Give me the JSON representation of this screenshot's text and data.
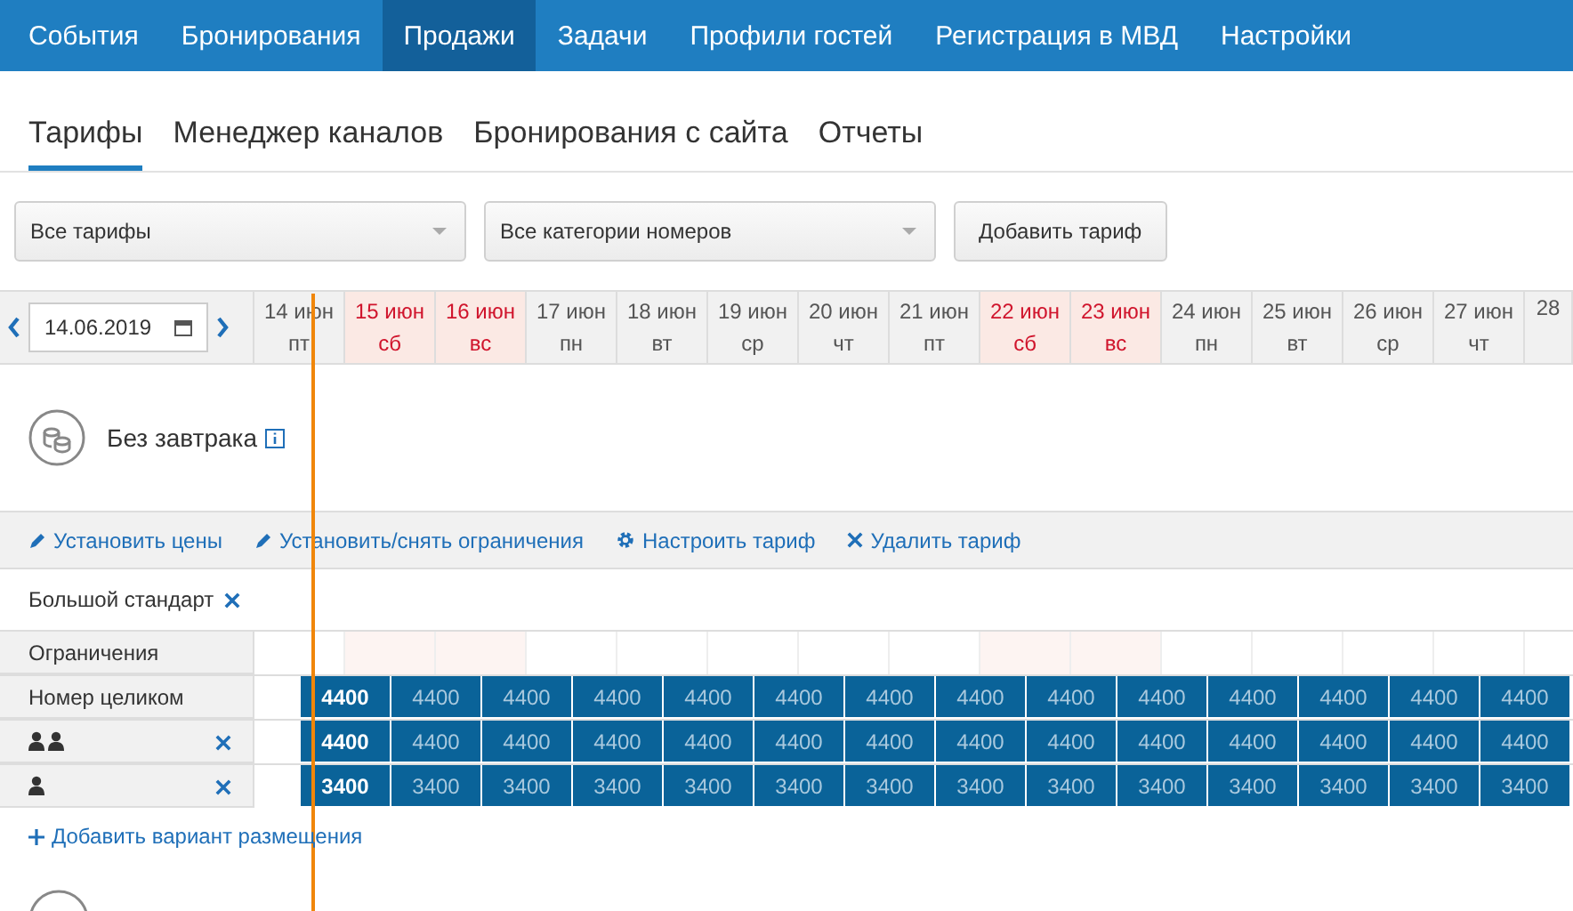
{
  "top_nav": [
    {
      "label": "События",
      "selected": false
    },
    {
      "label": "Бронирования",
      "selected": false
    },
    {
      "label": "Продажи",
      "selected": true
    },
    {
      "label": "Задачи",
      "selected": false
    },
    {
      "label": "Профили гостей",
      "selected": false
    },
    {
      "label": "Регистрация в МВД",
      "selected": false
    },
    {
      "label": "Настройки",
      "selected": false
    }
  ],
  "sub_tabs": [
    {
      "label": "Тарифы",
      "selected": true
    },
    {
      "label": "Менеджер каналов",
      "selected": false
    },
    {
      "label": "Бронирования с сайта",
      "selected": false
    },
    {
      "label": "Отчеты",
      "selected": false
    }
  ],
  "filters": {
    "tariff_select": "Все тарифы",
    "category_select": "Все категории номеров",
    "add_button": "Добавить тариф"
  },
  "date_field": {
    "value": "14.06.2019"
  },
  "days": [
    {
      "date": "14 июн",
      "weekday": "пт",
      "weekend": false
    },
    {
      "date": "15 июн",
      "weekday": "сб",
      "weekend": true
    },
    {
      "date": "16 июн",
      "weekday": "вс",
      "weekend": true
    },
    {
      "date": "17 июн",
      "weekday": "пн",
      "weekend": false
    },
    {
      "date": "18 июн",
      "weekday": "вт",
      "weekend": false
    },
    {
      "date": "19 июн",
      "weekday": "ср",
      "weekend": false
    },
    {
      "date": "20 июн",
      "weekday": "чт",
      "weekend": false
    },
    {
      "date": "21 июн",
      "weekday": "пт",
      "weekend": false
    },
    {
      "date": "22 июн",
      "weekday": "сб",
      "weekend": true
    },
    {
      "date": "23 июн",
      "weekday": "вс",
      "weekend": true
    },
    {
      "date": "24 июн",
      "weekday": "пн",
      "weekend": false
    },
    {
      "date": "25 июн",
      "weekday": "вт",
      "weekend": false
    },
    {
      "date": "26 июн",
      "weekday": "ср",
      "weekend": false
    },
    {
      "date": "27 июн",
      "weekday": "чт",
      "weekend": false
    },
    {
      "date": "28",
      "weekend": false
    }
  ],
  "tariff": {
    "name": "Без завтрака"
  },
  "actions": [
    {
      "kind": "pencil",
      "label": "Установить цены"
    },
    {
      "kind": "pencil",
      "label": "Установить/снять ограничения"
    },
    {
      "kind": "gear",
      "label": "Настроить тариф"
    },
    {
      "kind": "cross",
      "label": "Удалить тариф"
    }
  ],
  "room": {
    "name": "Большой стандарт",
    "restrictions_label": "Ограничения",
    "rows": [
      {
        "kind": "text",
        "label": "Номер целиком",
        "cells": [
          {
            "value": "4400",
            "current": true
          },
          {
            "value": "4400",
            "current": false
          },
          {
            "value": "4400",
            "current": false
          },
          {
            "value": "4400",
            "current": false
          },
          {
            "value": "4400",
            "current": false
          },
          {
            "value": "4400",
            "current": false
          },
          {
            "value": "4400",
            "current": false
          },
          {
            "value": "4400",
            "current": false
          },
          {
            "value": "4400",
            "current": false
          },
          {
            "value": "4400",
            "current": false
          },
          {
            "value": "4400",
            "current": false
          },
          {
            "value": "4400",
            "current": false
          },
          {
            "value": "4400",
            "current": false
          },
          {
            "value": "4400",
            "current": false
          }
        ]
      },
      {
        "kind": "guests2",
        "cells": [
          {
            "value": "4400",
            "current": true
          },
          {
            "value": "4400",
            "current": false
          },
          {
            "value": "4400",
            "current": false
          },
          {
            "value": "4400",
            "current": false
          },
          {
            "value": "4400",
            "current": false
          },
          {
            "value": "4400",
            "current": false
          },
          {
            "value": "4400",
            "current": false
          },
          {
            "value": "4400",
            "current": false
          },
          {
            "value": "4400",
            "current": false
          },
          {
            "value": "4400",
            "current": false
          },
          {
            "value": "4400",
            "current": false
          },
          {
            "value": "4400",
            "current": false
          },
          {
            "value": "4400",
            "current": false
          },
          {
            "value": "4400",
            "current": false
          }
        ]
      },
      {
        "kind": "guests1",
        "cells": [
          {
            "value": "3400",
            "current": true
          },
          {
            "value": "3400",
            "current": false
          },
          {
            "value": "3400",
            "current": false
          },
          {
            "value": "3400",
            "current": false
          },
          {
            "value": "3400",
            "current": false
          },
          {
            "value": "3400",
            "current": false
          },
          {
            "value": "3400",
            "current": false
          },
          {
            "value": "3400",
            "current": false
          },
          {
            "value": "3400",
            "current": false
          },
          {
            "value": "3400",
            "current": false
          },
          {
            "value": "3400",
            "current": false
          },
          {
            "value": "3400",
            "current": false
          },
          {
            "value": "3400",
            "current": false
          },
          {
            "value": "3400",
            "current": false
          }
        ]
      }
    ],
    "add_link": "Добавить вариант размещения"
  }
}
